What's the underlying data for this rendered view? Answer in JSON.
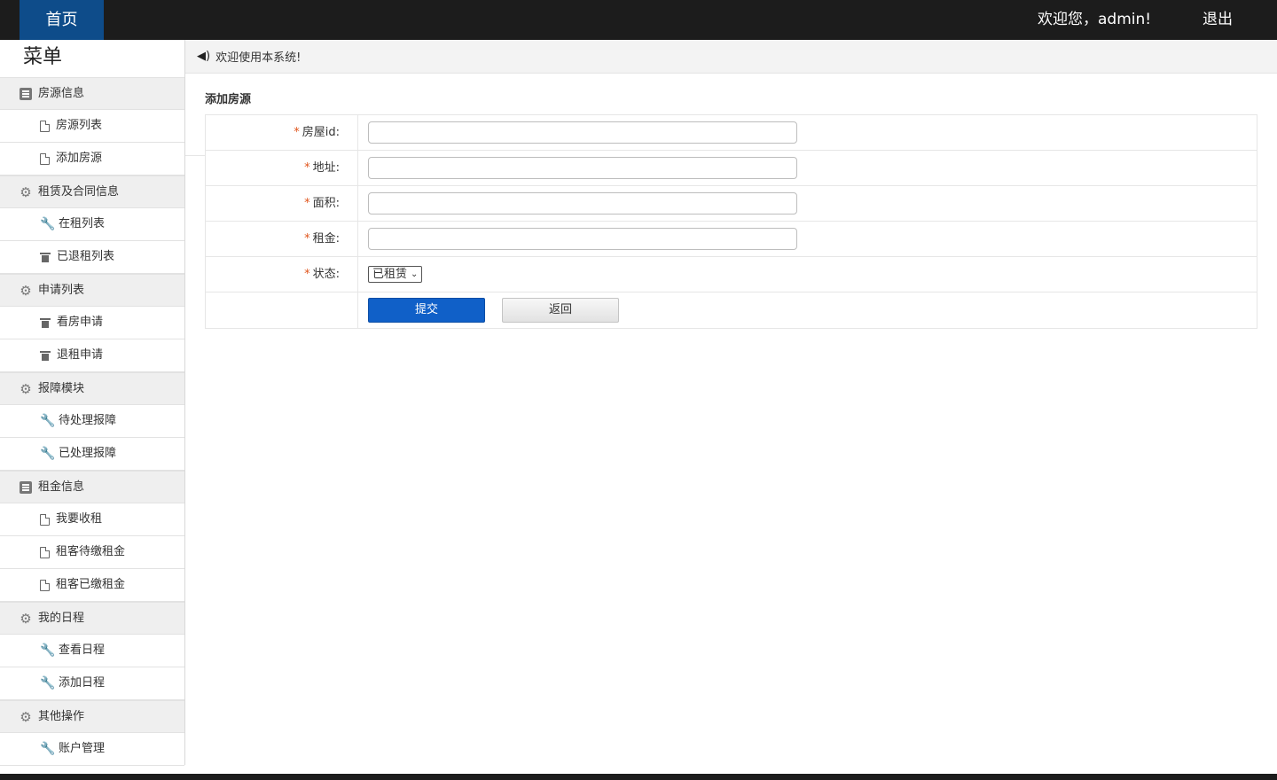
{
  "topbar": {
    "home_label": "首页",
    "welcome_text": "欢迎您，admin!",
    "logout_label": "退出"
  },
  "sidebar": {
    "title": "菜单",
    "groups": [
      {
        "label": "房源信息",
        "icon": "list-icon",
        "items": [
          {
            "label": "房源列表",
            "icon": "document-icon"
          },
          {
            "label": "添加房源",
            "icon": "document-icon"
          }
        ]
      },
      {
        "label": "租赁及合同信息",
        "icon": "gear-icon",
        "items": [
          {
            "label": "在租列表",
            "icon": "wrench-icon"
          },
          {
            "label": "已退租列表",
            "icon": "trash-icon"
          }
        ]
      },
      {
        "label": "申请列表",
        "icon": "gear-icon",
        "items": [
          {
            "label": "看房申请",
            "icon": "trash-icon"
          },
          {
            "label": "退租申请",
            "icon": "trash-icon"
          }
        ]
      },
      {
        "label": "报障模块",
        "icon": "gear-icon",
        "items": [
          {
            "label": "待处理报障",
            "icon": "wrench-icon"
          },
          {
            "label": "已处理报障",
            "icon": "wrench-icon"
          }
        ]
      },
      {
        "label": "租金信息",
        "icon": "list-icon",
        "items": [
          {
            "label": "我要收租",
            "icon": "document-icon"
          },
          {
            "label": "租客待缴租金",
            "icon": "document-icon"
          },
          {
            "label": "租客已缴租金",
            "icon": "document-icon"
          }
        ]
      },
      {
        "label": "我的日程",
        "icon": "gear-icon",
        "items": [
          {
            "label": "查看日程",
            "icon": "wrench-icon"
          },
          {
            "label": "添加日程",
            "icon": "wrench-icon"
          }
        ]
      },
      {
        "label": "其他操作",
        "icon": "gear-icon",
        "items": [
          {
            "label": "账户管理",
            "icon": "wrench-icon"
          }
        ]
      }
    ]
  },
  "notice": {
    "icon": "speaker-icon",
    "text": "欢迎使用本系统!"
  },
  "form": {
    "title": "添加房源",
    "required_mark": "*",
    "fields": {
      "house_id": {
        "label": "房屋id:",
        "value": ""
      },
      "address": {
        "label": "地址:",
        "value": ""
      },
      "area": {
        "label": "面积:",
        "value": ""
      },
      "rent": {
        "label": "租金:",
        "value": ""
      },
      "status": {
        "label": "状态:",
        "selected": "已租赁"
      }
    },
    "submit_label": "提交",
    "back_label": "返回"
  },
  "colors": {
    "topbar_bg": "#1c1c1c",
    "home_tab_bg": "#0e4c8a",
    "primary_button": "#1060c8",
    "required_mark": "#e0541b"
  }
}
